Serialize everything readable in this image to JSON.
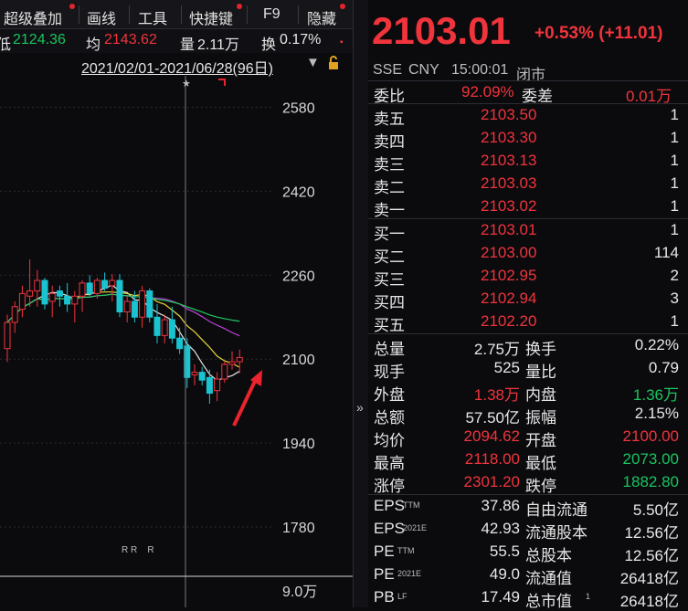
{
  "toolbar": {
    "items": [
      "超级叠加",
      "画线",
      "工具",
      "快捷键",
      "F9",
      "隐藏"
    ]
  },
  "stats": {
    "low_label": "低",
    "low_value": "2124.36",
    "avg_label": "均",
    "avg_value": "2143.62",
    "vol_label": "量",
    "vol_value": "2.11万",
    "turnover_label": "换",
    "turnover_value": "0.17%",
    "more": "▪"
  },
  "date_range": "2021/02/01-2021/06/28(96日)",
  "axis": {
    "y_ticks": [
      "2580",
      "2420",
      "2260",
      "2100",
      "1940",
      "1780"
    ],
    "volume_tick": "9.0万",
    "markers": "R R    R"
  },
  "colors": {
    "up": "#f0343c",
    "down": "#19c4d0",
    "ma5": "#e8e8e8",
    "ma10": "#e8d43a",
    "ma20": "#c040d8",
    "ma60": "#20c860",
    "ma120": "#7090e0",
    "arrow": "#e8242c"
  },
  "chart_data": {
    "type": "candlestick",
    "y_range": [
      1700,
      2640
    ],
    "title": "",
    "candles": [
      {
        "o": 2120,
        "h": 2185,
        "l": 2095,
        "c": 2170
      },
      {
        "o": 2170,
        "h": 2210,
        "l": 2150,
        "c": 2200
      },
      {
        "o": 2195,
        "h": 2240,
        "l": 2180,
        "c": 2225
      },
      {
        "o": 2220,
        "h": 2290,
        "l": 2200,
        "c": 2230
      },
      {
        "o": 2230,
        "h": 2270,
        "l": 2200,
        "c": 2250
      },
      {
        "o": 2250,
        "h": 2255,
        "l": 2195,
        "c": 2205
      },
      {
        "o": 2210,
        "h": 2240,
        "l": 2180,
        "c": 2225
      },
      {
        "o": 2230,
        "h": 2240,
        "l": 2200,
        "c": 2220
      },
      {
        "o": 2220,
        "h": 2245,
        "l": 2190,
        "c": 2205
      },
      {
        "o": 2205,
        "h": 2230,
        "l": 2170,
        "c": 2220
      },
      {
        "o": 2220,
        "h": 2250,
        "l": 2190,
        "c": 2245
      },
      {
        "o": 2245,
        "h": 2260,
        "l": 2220,
        "c": 2225
      },
      {
        "o": 2225,
        "h": 2255,
        "l": 2215,
        "c": 2250
      },
      {
        "o": 2250,
        "h": 2265,
        "l": 2230,
        "c": 2235
      },
      {
        "o": 2240,
        "h": 2262,
        "l": 2210,
        "c": 2250
      },
      {
        "o": 2250,
        "h": 2262,
        "l": 2180,
        "c": 2190
      },
      {
        "o": 2190,
        "h": 2220,
        "l": 2170,
        "c": 2210
      },
      {
        "o": 2210,
        "h": 2230,
        "l": 2170,
        "c": 2180
      },
      {
        "o": 2180,
        "h": 2240,
        "l": 2160,
        "c": 2230
      },
      {
        "o": 2230,
        "h": 2235,
        "l": 2170,
        "c": 2180
      },
      {
        "o": 2180,
        "h": 2205,
        "l": 2130,
        "c": 2145
      },
      {
        "o": 2145,
        "h": 2185,
        "l": 2130,
        "c": 2175
      },
      {
        "o": 2175,
        "h": 2200,
        "l": 2130,
        "c": 2140
      },
      {
        "o": 2140,
        "h": 2160,
        "l": 2110,
        "c": 2120
      },
      {
        "o": 2125,
        "h": 2140,
        "l": 2045,
        "c": 2065
      },
      {
        "o": 2070,
        "h": 2090,
        "l": 2050,
        "c": 2075
      },
      {
        "o": 2075,
        "h": 2085,
        "l": 2050,
        "c": 2060
      },
      {
        "o": 2065,
        "h": 2080,
        "l": 2015,
        "c": 2035
      },
      {
        "o": 2040,
        "h": 2075,
        "l": 2020,
        "c": 2062
      },
      {
        "o": 2062,
        "h": 2095,
        "l": 2055,
        "c": 2090
      },
      {
        "o": 2090,
        "h": 2115,
        "l": 2080,
        "c": 2095
      },
      {
        "o": 2095,
        "h": 2118,
        "l": 2073,
        "c": 2103
      }
    ]
  },
  "quote": {
    "price": "2103.01",
    "change": "+0.53% (+11.01)",
    "exchange": "SSE",
    "currency": "CNY",
    "time": "15:00:01",
    "status": "闭市",
    "weibi_label": "委比",
    "weibi_value": "92.09%",
    "weicha_label": "委差",
    "weicha_value": "0.01万",
    "asks": [
      {
        "label": "卖五",
        "price": "2103.50",
        "qty": "1"
      },
      {
        "label": "卖四",
        "price": "2103.30",
        "qty": "1"
      },
      {
        "label": "卖三",
        "price": "2103.13",
        "qty": "1"
      },
      {
        "label": "卖二",
        "price": "2103.03",
        "qty": "1"
      },
      {
        "label": "卖一",
        "price": "2103.02",
        "qty": "1"
      }
    ],
    "bids": [
      {
        "label": "买一",
        "price": "2103.01",
        "qty": "1"
      },
      {
        "label": "买二",
        "price": "2103.00",
        "qty": "114"
      },
      {
        "label": "买三",
        "price": "2102.95",
        "qty": "2"
      },
      {
        "label": "买四",
        "price": "2102.94",
        "qty": "3"
      },
      {
        "label": "买五",
        "price": "2102.20",
        "qty": "1"
      }
    ],
    "metrics": [
      {
        "l1": "总量",
        "v1": "2.75万",
        "c1": "wht",
        "l2": "换手",
        "v2": "0.22%",
        "c2": "wht"
      },
      {
        "l1": "现手",
        "v1": "525",
        "c1": "wht",
        "l2": "量比",
        "v2": "0.79",
        "c2": "wht"
      },
      {
        "l1": "外盘",
        "v1": "1.38万",
        "c1": "red",
        "l2": "内盘",
        "v2": "1.36万",
        "c2": "green"
      },
      {
        "l1": "总额",
        "v1": "57.50亿",
        "c1": "wht",
        "l2": "振幅",
        "v2": "2.15%",
        "c2": "wht"
      },
      {
        "l1": "均价",
        "v1": "2094.62",
        "c1": "red",
        "l2": "开盘",
        "v2": "2100.00",
        "c2": "red"
      },
      {
        "l1": "最高",
        "v1": "2118.00",
        "c1": "red",
        "l2": "最低",
        "v2": "2073.00",
        "c2": "green"
      },
      {
        "l1": "涨停",
        "v1": "2301.20",
        "c1": "red",
        "l2": "跌停",
        "v2": "1882.80",
        "c2": "green"
      }
    ],
    "fundamentals": [
      {
        "l1": "EPS",
        "s1": "TTM",
        "v1": "37.86",
        "l2": "自由流通",
        "v2": "5.50亿"
      },
      {
        "l1": "EPS",
        "s1": "2021E",
        "v1": "42.93",
        "l2": "流通股本",
        "v2": "12.56亿"
      },
      {
        "l1": "PE",
        "s1": "TTM",
        "v1": "55.5",
        "l2": "总股本",
        "v2": "12.56亿"
      },
      {
        "l1": "PE",
        "s1": "2021E",
        "v1": "49.0",
        "l2": "流通值",
        "v2": "26418亿"
      },
      {
        "l1": "PB",
        "s1": "LF",
        "v1": "17.49",
        "l2": "总市值",
        "s2": "1",
        "v2": "26418亿"
      }
    ]
  },
  "divider_icon": "»"
}
